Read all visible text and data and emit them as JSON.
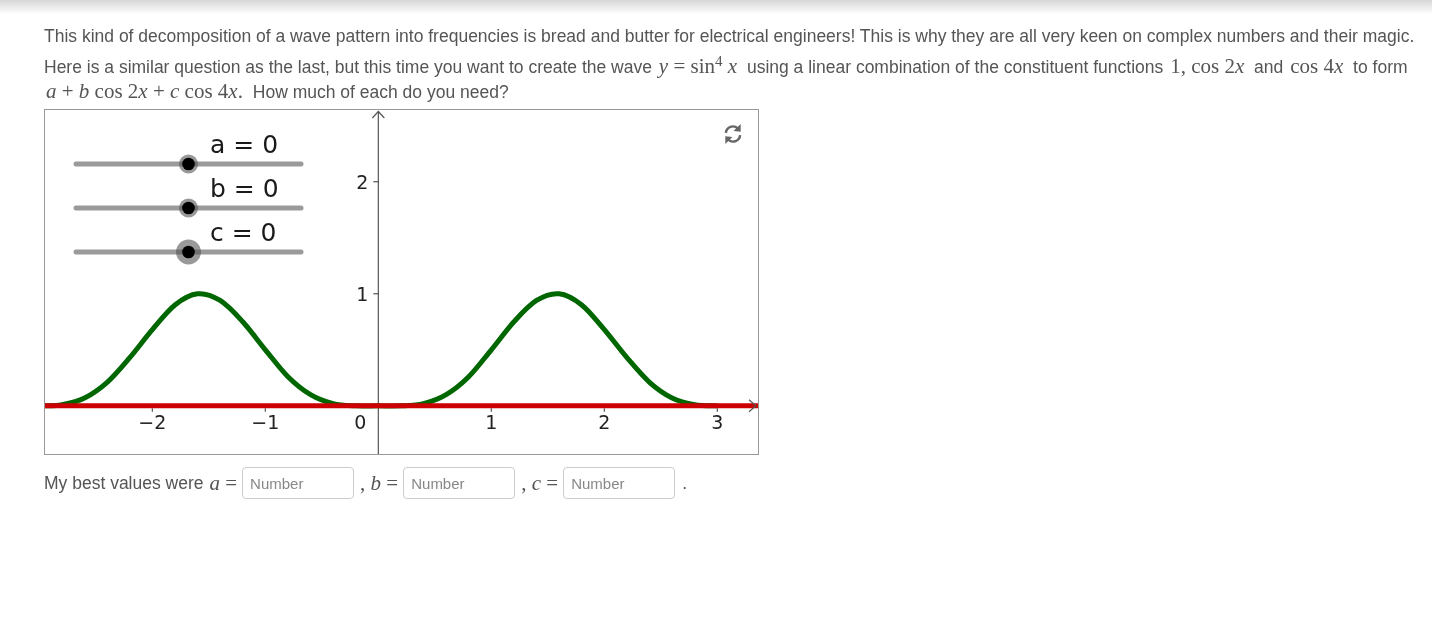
{
  "paragraphs": [
    {
      "segments": [
        {
          "kind": "text",
          "text": "This kind of decomposition of a wave pattern into frequencies is bread and butter for electrical engineers! This is why they are all very keen on complex numbers and their magic."
        }
      ]
    },
    {
      "segments": [
        {
          "kind": "text",
          "text": "Here is a similar question as the last, but this time you want to create the wave "
        },
        {
          "kind": "math",
          "text": "y = sin$^{4}$ x"
        },
        {
          "kind": "text",
          "text": " using a linear combination of the constituent functions "
        },
        {
          "kind": "math",
          "text": "1, cos 2x"
        },
        {
          "kind": "text",
          "text": " and "
        },
        {
          "kind": "math",
          "text": "cos 4x"
        },
        {
          "kind": "text",
          "text": " to form "
        },
        {
          "kind": "math",
          "text": "a + b cos 2x + c cos 4x."
        },
        {
          "kind": "text",
          "text": " How much of each do you need?"
        }
      ]
    }
  ],
  "applet": {
    "sliders": [
      {
        "label": "a = 0",
        "level": 0.5,
        "selected": false
      },
      {
        "label": "b = 0",
        "level": 0.5,
        "selected": false
      },
      {
        "label": "c = 0",
        "level": 0.5,
        "selected": true
      }
    ],
    "origin_label": "0",
    "chart_data": {
      "type": "line",
      "x": [
        -2.95,
        -2.8,
        -2.6,
        -2.4,
        -2.2,
        -2,
        -1.8,
        -1.6,
        -1.4,
        -1.2,
        -1,
        -0.8,
        -0.6,
        -0.4,
        -0.2,
        0,
        0.2,
        0.4,
        0.6,
        0.8,
        1,
        1.2,
        1.4,
        1.6,
        1.8,
        2,
        2.2,
        2.4,
        2.6,
        2.8,
        3,
        3.2,
        3.36
      ],
      "series": [
        {
          "color": "#006600",
          "values": [
            0,
            0.01,
            0.07,
            0.21,
            0.43,
            0.68,
            0.9,
            1,
            0.94,
            0.75,
            0.5,
            0.26,
            0.1,
            0.02,
            0,
            0,
            0,
            0.02,
            0.1,
            0.26,
            0.5,
            0.75,
            0.94,
            1,
            0.9,
            0.68,
            0.43,
            0.21,
            0.07,
            0.01,
            0,
            null,
            null
          ]
        },
        {
          "color": "#cc0000",
          "values": [
            0,
            0,
            0,
            0,
            0,
            0,
            0,
            0,
            0,
            0,
            0,
            0,
            0,
            0,
            0,
            0,
            0,
            0,
            0,
            0,
            0,
            0,
            0,
            0,
            0,
            0,
            0,
            0,
            0,
            0,
            0,
            0,
            0
          ]
        }
      ],
      "xlim": [
        -2.95,
        3.36
      ],
      "ylim": [
        -0.43,
        2.64
      ],
      "xticks": [
        {
          "value": -2,
          "label": "−2"
        },
        {
          "value": -1,
          "label": "−1"
        },
        1,
        2,
        3
      ],
      "yticks": [
        1,
        2
      ]
    }
  },
  "answer": {
    "prompt": "My best values were",
    "fields": [
      {
        "label": "a =",
        "placeholder": "Number"
      },
      {
        "label": ", b =",
        "placeholder": "Number"
      },
      {
        "label": ", c =",
        "placeholder": "Number"
      }
    ],
    "end": "."
  }
}
